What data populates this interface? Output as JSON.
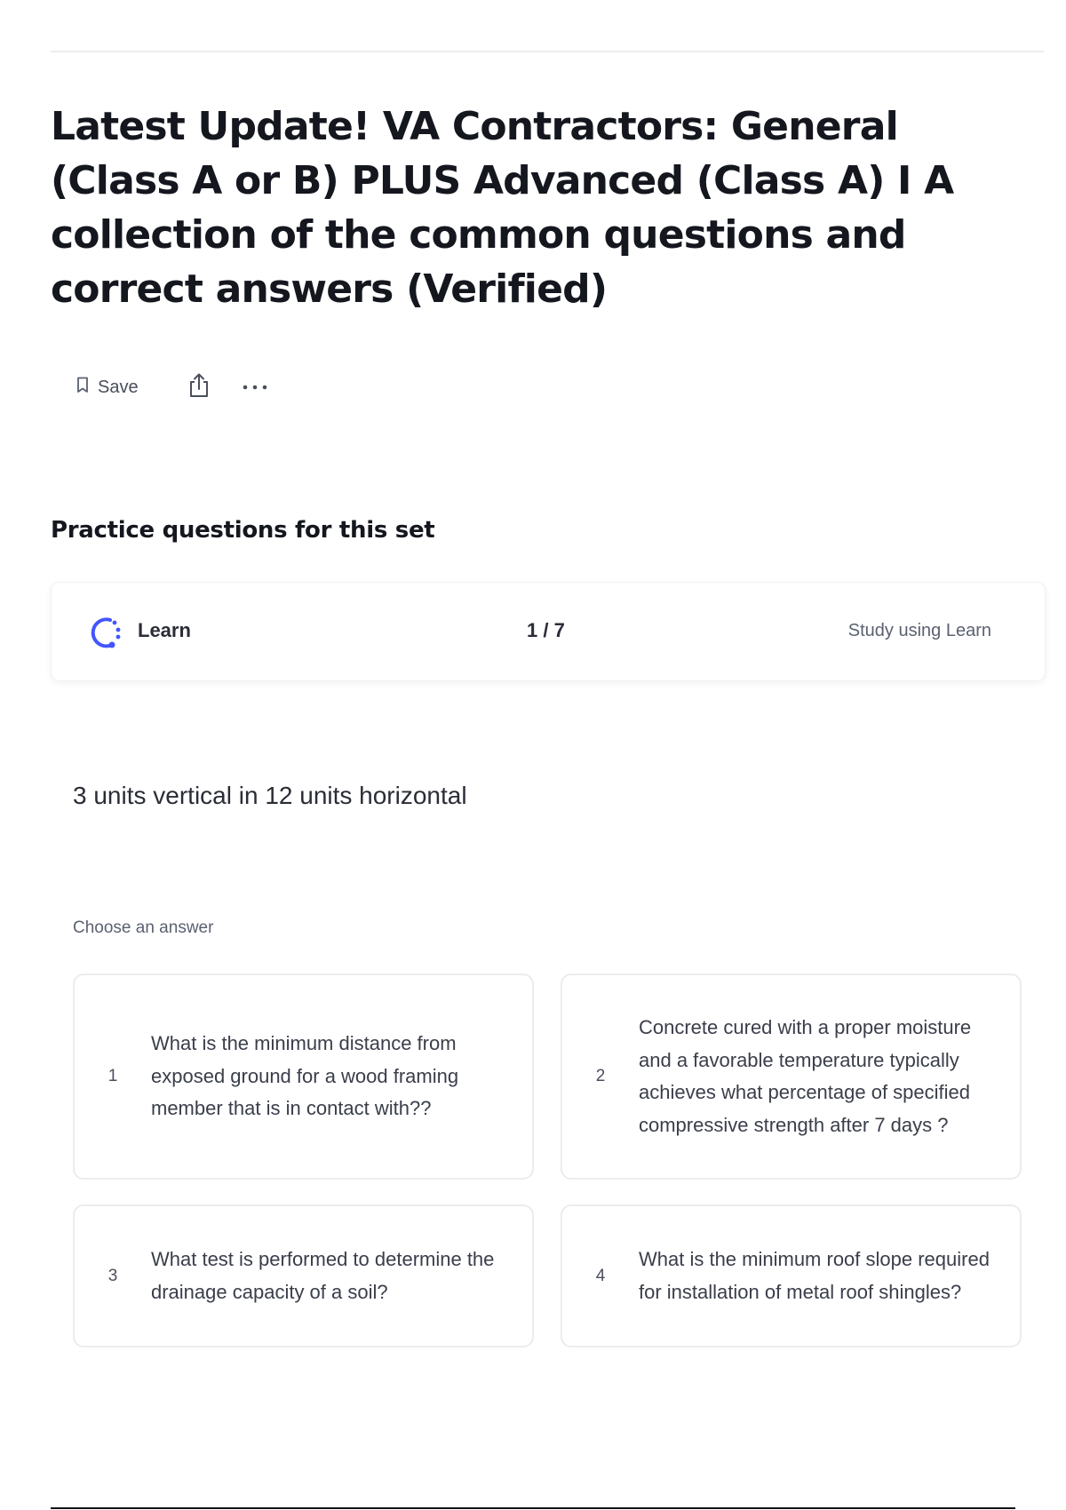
{
  "page": {
    "title": "Latest Update! VA Contractors: General (Class A or B) PLUS Advanced (Class A) I A collection of the common questions and correct answers (Verified)"
  },
  "toolbar": {
    "save_label": "Save",
    "save_icon": "bookmark-icon",
    "share_icon": "share-icon",
    "more_icon": "more-horizontal-icon"
  },
  "practice": {
    "heading": "Practice questions for this set",
    "mode_label": "Learn",
    "mode_icon": "learn-icon",
    "progress": "1 / 7",
    "study_link": "Study using Learn",
    "accent_color": "#4255ff"
  },
  "question": {
    "prompt": "3 units vertical in 12 units horizontal",
    "choose_label": "Choose an answer",
    "answers": [
      {
        "number": "1",
        "text": "What is the minimum distance from exposed ground for a wood framing member that is in contact with??"
      },
      {
        "number": "2",
        "text": "Concrete cured with a proper moisture and a favorable temperature typically achieves what percentage of specified compressive strength after 7 days ?"
      },
      {
        "number": "3",
        "text": "What test is performed to determine the drainage capacity of a soil?"
      },
      {
        "number": "4",
        "text": "What is the minimum roof slope required for installation of metal roof shingles?"
      }
    ]
  }
}
